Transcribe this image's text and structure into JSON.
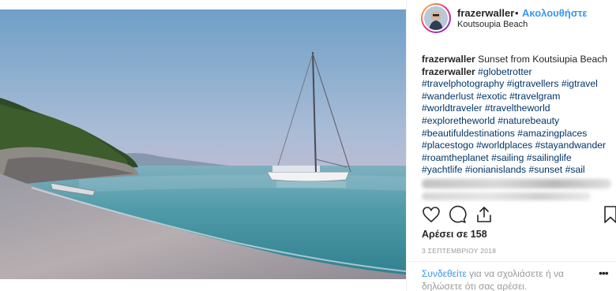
{
  "post": {
    "image_alt": "Sailboat anchored at sunset off Koutsoupia Beach"
  },
  "header": {
    "username": "frazerwaller",
    "separator": "•",
    "follow_label": "Ακολουθήστε",
    "location": "Koutsoupia Beach"
  },
  "caption": {
    "first_username": "frazerwaller",
    "first_text": "Sunset from Koutsiupia Beach",
    "second_username": "frazerwaller",
    "hashtags_line1": "#globetrotter",
    "lines": [
      "#travelphotography #igtravellers #igtravel",
      "#wanderlust #exotic #travelgram",
      "#worldtraveler #traveltheworld",
      "#exploretheworld #naturebeauty",
      "#beautifuldestinations #amazingplaces",
      "#placestogo #worldplaces #stayandwander",
      "#roamtheplanet #sailing #sailinglife",
      "#yachtlife #ionianislands #sunset #sail"
    ]
  },
  "actions": {
    "like_icon": "heart-icon",
    "comment_icon": "comment-icon",
    "share_icon": "share-icon",
    "save_icon": "bookmark-icon"
  },
  "likes": {
    "label": "Αρέσει σε 158"
  },
  "date": "3 ΣΕΠΤΕΜΒΡΙΟΥ 2018",
  "footer": {
    "login_link": "Συνδεθείτε",
    "login_text": " για να σχολιάσετε ή να δηλώσετε ότι σας αρέσει.",
    "more_label": "•••"
  },
  "colors": {
    "accent": "#3897f0",
    "hashtag": "#003569",
    "text": "#262626",
    "muted": "#999999"
  }
}
